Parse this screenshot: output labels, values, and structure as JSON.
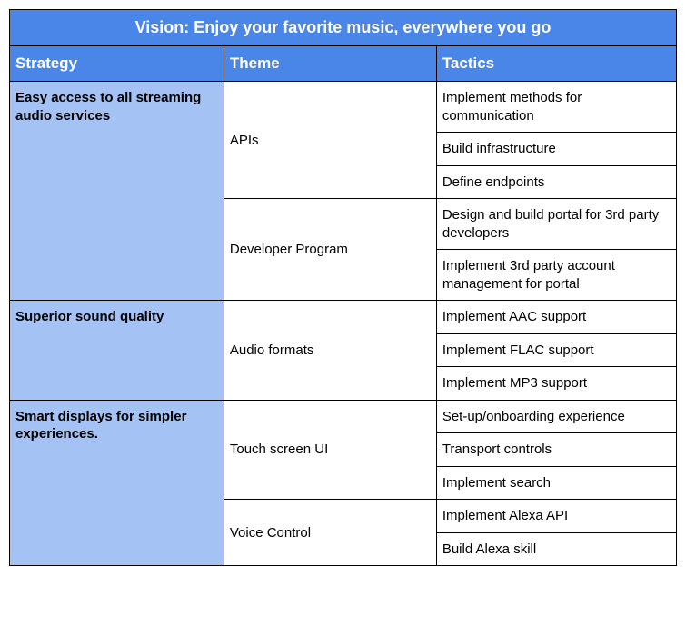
{
  "vision": "Vision: Enjoy your favorite music, everywhere you go",
  "headers": {
    "strategy": "Strategy",
    "theme": "Theme",
    "tactics": "Tactics"
  },
  "strategies": [
    {
      "label": "Easy access to all streaming audio services",
      "themes": [
        {
          "label": "APIs",
          "tactics": [
            "Implement methods for communication",
            "Build infrastructure",
            "Define endpoints"
          ]
        },
        {
          "label": "Developer Program",
          "tactics": [
            "Design and build portal for 3rd party developers",
            "Implement 3rd party account management for portal"
          ]
        }
      ]
    },
    {
      "label": "Superior sound quality",
      "themes": [
        {
          "label": "Audio formats",
          "tactics": [
            "Implement AAC support",
            "Implement FLAC support",
            "Implement MP3 support"
          ]
        }
      ]
    },
    {
      "label": "Smart displays for simpler experiences.",
      "themes": [
        {
          "label": "Touch screen UI",
          "tactics": [
            "Set-up/onboarding experience",
            "Transport controls",
            "Implement search"
          ]
        },
        {
          "label": "Voice Control",
          "tactics": [
            "Implement Alexa API",
            "Build Alexa skill"
          ]
        }
      ]
    }
  ]
}
